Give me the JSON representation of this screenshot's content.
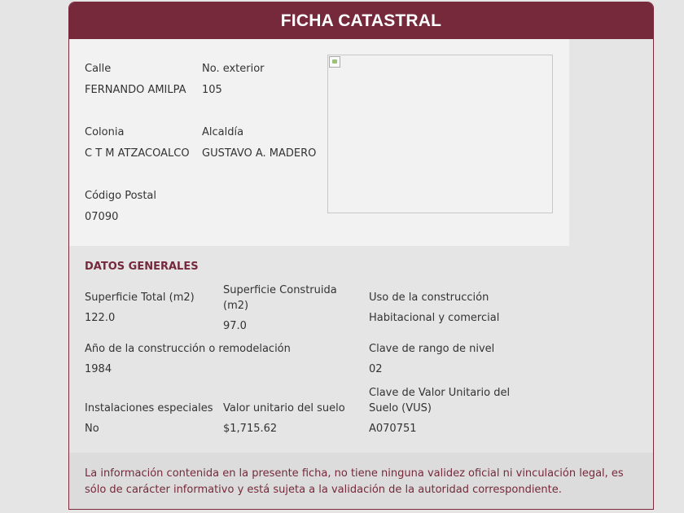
{
  "header": {
    "title": "FICHA CATASTRAL"
  },
  "address": {
    "calle_label": "Calle",
    "calle_value": "FERNANDO AMILPA",
    "no_exterior_label": "No. exterior",
    "no_exterior_value": "105",
    "colonia_label": "Colonia",
    "colonia_value": "C T M ATZACOALCO",
    "alcaldia_label": "Alcaldía",
    "alcaldia_value": "GUSTAVO A. MADERO",
    "cp_label": "Código Postal",
    "cp_value": "07090"
  },
  "photo": {
    "icon": "broken-image-icon"
  },
  "datos_generales": {
    "title": "DATOS GENERALES",
    "sup_total_label": "Superficie Total (m2)",
    "sup_total_value": "122.0",
    "sup_construida_label": "Superficie Construida (m2)",
    "sup_construida_value": "97.0",
    "uso_label": "Uso de la construcción",
    "uso_value": "Habitacional y comercial",
    "anio_label": "Año de la construcción o remodelación",
    "anio_value": "1984",
    "clave_rango_label": "Clave de rango de nivel",
    "clave_rango_value": "02",
    "instalaciones_label": "Instalaciones especiales",
    "instalaciones_value": "No",
    "valor_unitario_label": "Valor unitario del suelo",
    "valor_unitario_value": "$1,715.62",
    "clave_vus_label": "Clave de Valor Unitario del Suelo (VUS)",
    "clave_vus_value": "A070751"
  },
  "footer": {
    "disclaimer": "La información contenida en la presente ficha, no tiene ninguna validez oficial ni vinculación legal, es sólo de carácter informativo y está sujeta a la validación de la autoridad correspondiente."
  },
  "colors": {
    "brand": "#75293b",
    "background": "#e5e5e5",
    "panel": "#f2f2f2",
    "footer": "#dcdcdc"
  }
}
